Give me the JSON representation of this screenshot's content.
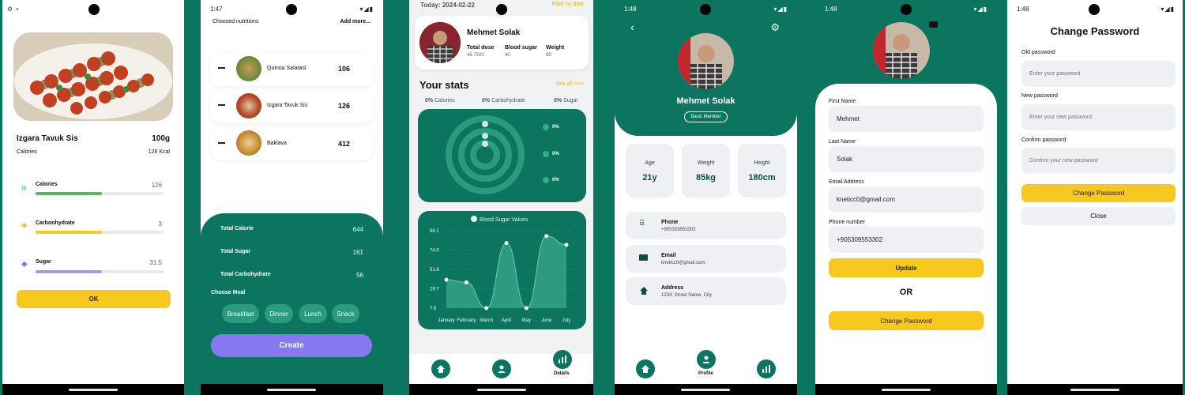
{
  "colors": {
    "brand": "#0b7560",
    "yellow": "#f7c81d",
    "purple": "#8678ee",
    "green": "#4cbb62",
    "lav": "#a79be0"
  },
  "s1": {
    "status_icons": "⚙ ▪",
    "food_name": "Izgara Tavuk Sis",
    "weight": "100g",
    "cal_label": "Calories",
    "cal_value": "126 Kcal",
    "nutrients": [
      {
        "label": "Calories",
        "value": "126",
        "fraction": 0.52
      },
      {
        "label": "Carbonhydrate",
        "value": "3",
        "fraction": 0.52
      },
      {
        "label": "Sugar",
        "value": "31.5",
        "fraction": 0.52
      }
    ],
    "ok": "OK"
  },
  "s2": {
    "time": "1:47",
    "title": "Choosed nutritions",
    "add": "Add more...",
    "items": [
      {
        "name": "Quinoa Salatasi",
        "value": "106"
      },
      {
        "name": "Izgara Tavuk Sis",
        "value": "126"
      },
      {
        "name": "Baklava",
        "value": "412"
      }
    ],
    "totals": [
      {
        "label": "Total Calorie",
        "value": "644"
      },
      {
        "label": "Total Sugar",
        "value": "161"
      },
      {
        "label": "Total Carbohydrate",
        "value": "56"
      }
    ],
    "choose": "Choose Meal",
    "meals": [
      "Breakfast",
      "Dinner",
      "Lunch",
      "Snack"
    ],
    "create": "Create"
  },
  "s3": {
    "today": "Today: 2024-02-22",
    "filter": "Filter by date",
    "name": "Mehmet Solak",
    "stats": [
      {
        "label": "Total dose",
        "value": "46.7500"
      },
      {
        "label": "Blood sugar",
        "value": "40"
      },
      {
        "label": "Weight",
        "value": "85"
      }
    ],
    "your_stats": "Your stats",
    "see_all": "See all >>>",
    "pct": [
      {
        "v": "0%",
        "l": "Calories"
      },
      {
        "v": "0%",
        "l": "Carbohydrate"
      },
      {
        "v": "0%",
        "l": "Sugar"
      }
    ],
    "ring_legend": [
      "0%",
      "0%",
      "0%"
    ],
    "details": "Details"
  },
  "chart_data": {
    "type": "area",
    "title": "Blood Sugar Values",
    "categories": [
      "January",
      "February",
      "March",
      "April",
      "May",
      "June",
      "July"
    ],
    "values": [
      40,
      37,
      7.6,
      82,
      7.6,
      90,
      80
    ],
    "yticks": [
      "96.1",
      "74.0",
      "51.8",
      "29.7",
      "7.6"
    ],
    "ylim": [
      7.6,
      96.1
    ]
  },
  "s4": {
    "time": "1:48",
    "name": "Mehmet Solak",
    "badge": "Basic Member",
    "metrics": [
      {
        "label": "Age",
        "value": "21y"
      },
      {
        "label": "Weight",
        "value": "85kg"
      },
      {
        "label": "Height",
        "value": "180cm"
      }
    ],
    "info": [
      {
        "label": "Phone",
        "value": "+905309553302"
      },
      {
        "label": "Email",
        "value": "kneticc0@gmail.com"
      },
      {
        "label": "Address",
        "value": "1234, Street Name, City"
      }
    ],
    "profile": "Profile"
  },
  "s5": {
    "time": "1:48",
    "fields": [
      {
        "label": "First Name",
        "value": "Mehmet"
      },
      {
        "label": "Last Name",
        "value": "Solak"
      },
      {
        "label": "Email Address",
        "value": "kneticc0@gmail.com"
      },
      {
        "label": "Phone number",
        "value": "+905309553302"
      }
    ],
    "update": "Update",
    "or": "OR",
    "change": "Change Password"
  },
  "s6": {
    "time": "1:48",
    "title": "Change Password",
    "fields": [
      {
        "label": "Old password",
        "placeholder": "Enter your password"
      },
      {
        "label": "New password",
        "placeholder": "Enter your new password"
      },
      {
        "label": "Confirm password",
        "placeholder": "Confirm your new password"
      }
    ],
    "change": "Change Password",
    "close": "Close"
  }
}
